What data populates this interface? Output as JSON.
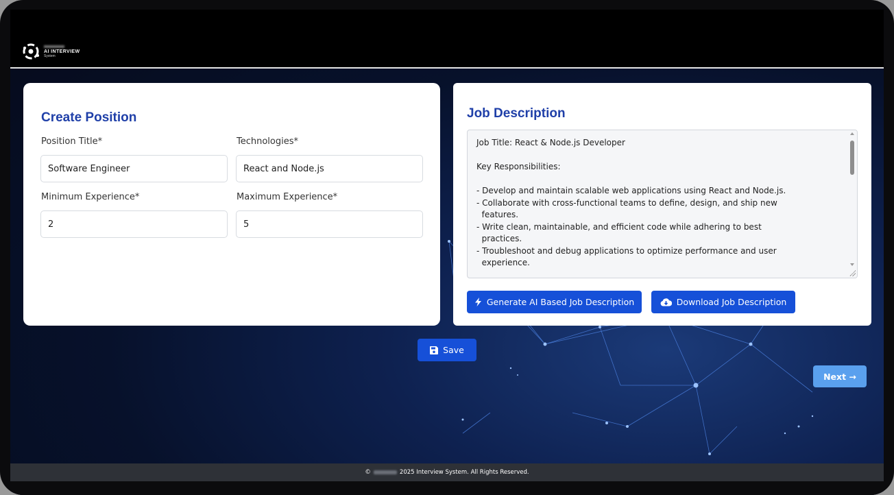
{
  "brand": {
    "logo_main": "AI INTERVIEW",
    "logo_sub": "System"
  },
  "create_position": {
    "title": "Create Position",
    "fields": {
      "position_title": {
        "label": "Position Title*",
        "value": "Software Engineer"
      },
      "technologies": {
        "label": "Technologies*",
        "value": "React and Node.js"
      },
      "min_experience": {
        "label": "Minimum Experience*",
        "value": "2"
      },
      "max_experience": {
        "label": "Maximum Experience*",
        "value": "5"
      }
    }
  },
  "job_description": {
    "title": "Job Description",
    "text": "Job Title: React & Node.js Developer\n\nKey Responsibilities:\n\n- Develop and maintain scalable web applications using React and Node.js.\n- Collaborate with cross-functional teams to define, design, and ship new\n  features.\n- Write clean, maintainable, and efficient code while adhering to best\n  practices.\n- Troubleshoot and debug applications to optimize performance and user\n  experience.",
    "generate_label": "Generate AI Based Job Description",
    "download_label": "Download Job Description"
  },
  "actions": {
    "save_label": "Save",
    "next_label": "Next →"
  },
  "footer": {
    "prefix": "©",
    "text": "2025 Interview System. All Rights Reserved."
  },
  "colors": {
    "primary": "#1650d8",
    "heading": "#1f3fa8",
    "next_button": "#5aa0ee",
    "footer_bg": "#2e3137"
  }
}
